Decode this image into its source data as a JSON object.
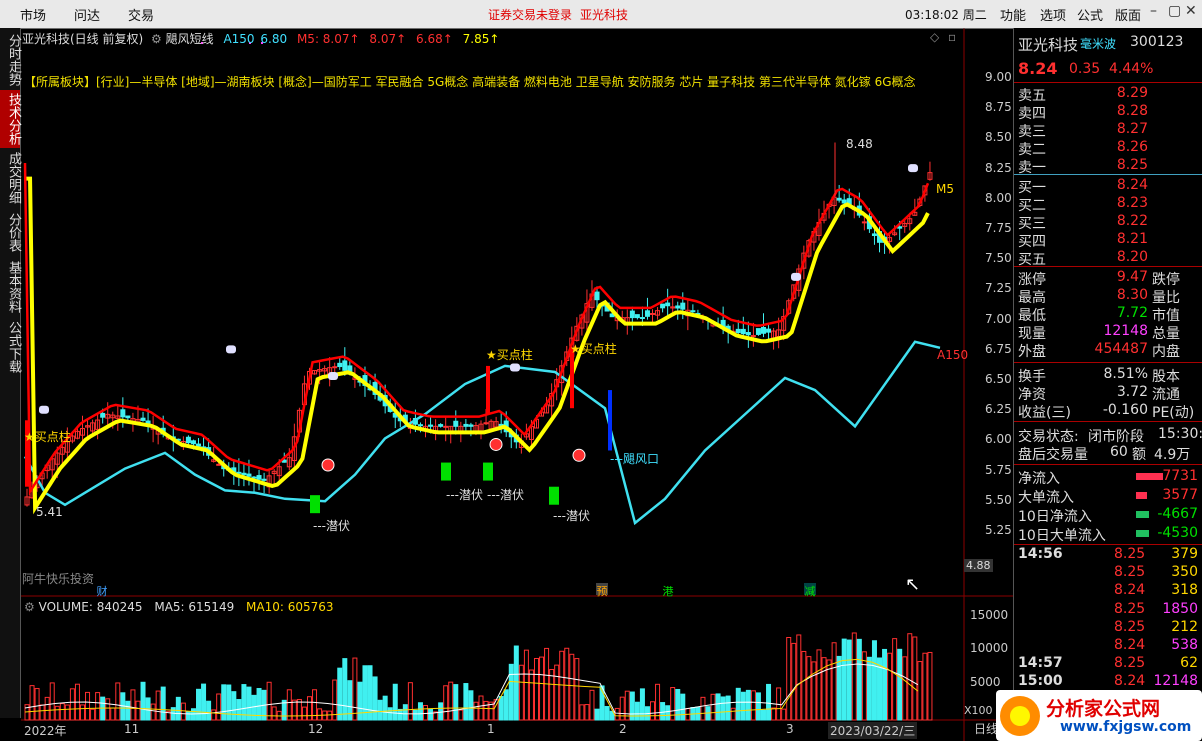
{
  "topbar": {
    "menu": [
      "市场",
      "问达",
      "交易"
    ],
    "warning": "证券交易未登录",
    "stock_name": "亚光科技",
    "clock": "03:18:02 周二",
    "right_menu": [
      "功能",
      "选项",
      "公式",
      "版面"
    ]
  },
  "left_tabs": [
    "分时走势",
    "技术分析",
    "成交明细",
    "分价表",
    "基本资料",
    "公式下载"
  ],
  "chart_header": {
    "title": "亚光科技(日线 前复权)",
    "indicator": "飓风短线",
    "a150_label": "A150",
    "a150_value": "6.80",
    "m5_label": "M5: 8.07",
    "values": [
      "8.07",
      "6.68",
      "7.85"
    ]
  },
  "sector_line": "【所属板块】[行业]—半导体 [地域]—湖南板块 [概念]—国防军工 军民融合 5G概念 高端装备 燃料电池 卫星导航 安防服务 芯片 量子科技 第三代半导体 氮化镓 6G概念",
  "annotations": {
    "buy": "★买点柱",
    "hide": "---潜伏",
    "wind": "---飓风口",
    "high": "8.48",
    "low": "5.41",
    "m5_tag": "M5",
    "a150_tag": "A150",
    "watermark_left": "阿牛快乐投资",
    "cursor_price": "4.88",
    "events": [
      "财",
      "预",
      "港",
      "减"
    ]
  },
  "price_axis": [
    "9.00",
    "8.75",
    "8.50",
    "8.25",
    "8.00",
    "7.75",
    "7.50",
    "7.25",
    "7.00",
    "6.75",
    "6.50",
    "6.25",
    "6.00",
    "5.75",
    "5.50",
    "5.25"
  ],
  "volume_header": {
    "volume": "VOLUME: 840245",
    "ma5": "MA5: 615149",
    "ma10": "MA10: 605763"
  },
  "volume_axis": [
    "15000",
    "10000",
    "5000"
  ],
  "volume_unit": "X100",
  "x_axis": [
    "2022年",
    "11",
    "12",
    "1",
    "2",
    "3",
    "2023/03/22/三"
  ],
  "right_panel": {
    "name": "亚光科技",
    "tag": "毫米波",
    "code": "300123",
    "price": "8.24",
    "change": "0.35",
    "pct": "4.44%",
    "asks": [
      {
        "label": "卖五",
        "price": "8.29"
      },
      {
        "label": "卖四",
        "price": "8.28"
      },
      {
        "label": "卖三",
        "price": "8.27"
      },
      {
        "label": "卖二",
        "price": "8.26"
      },
      {
        "label": "卖一",
        "price": "8.25"
      }
    ],
    "bids": [
      {
        "label": "买一",
        "price": "8.24"
      },
      {
        "label": "买二",
        "price": "8.23"
      },
      {
        "label": "买三",
        "price": "8.22"
      },
      {
        "label": "买四",
        "price": "8.21"
      },
      {
        "label": "买五",
        "price": "8.20"
      }
    ],
    "stats": [
      {
        "l": "涨停",
        "v": "9.47",
        "c": "red",
        "r": "跌停"
      },
      {
        "l": "最高",
        "v": "8.30",
        "c": "red",
        "r": "量比"
      },
      {
        "l": "最低",
        "v": "7.72",
        "c": "green",
        "r": "市值"
      },
      {
        "l": "现量",
        "v": "12148",
        "c": "magenta",
        "r": "总量"
      },
      {
        "l": "外盘",
        "v": "454487",
        "c": "red",
        "r": "内盘"
      }
    ],
    "stats2": [
      {
        "l": "换手",
        "v": "8.51%",
        "r": "股本"
      },
      {
        "l": "净资",
        "v": "3.72",
        "r": "流通"
      },
      {
        "l": "收益(三)",
        "v": "-0.160",
        "r": "PE(动)"
      }
    ],
    "status": {
      "l": "交易状态:",
      "v": "闭市阶段",
      "t": "15:30:"
    },
    "after": {
      "l": "盘后交易量",
      "v": "60",
      "r": "额",
      "r2": "4.9万"
    },
    "flows": [
      {
        "l": "净流入",
        "v": "7731",
        "c": "red",
        "bar": 0.95
      },
      {
        "l": "大单流入",
        "v": "3577",
        "c": "red",
        "bar": 0.4
      },
      {
        "l": "10日净流入",
        "v": "-4667",
        "c": "green",
        "bar": 0.45
      },
      {
        "l": "10日大单流入",
        "v": "-4530",
        "c": "green",
        "bar": 0.45
      }
    ],
    "ticks": [
      {
        "t": "14:56",
        "p": "8.25",
        "v": "379",
        "c": "yellow"
      },
      {
        "t": "",
        "p": "8.25",
        "v": "350",
        "c": "yellow"
      },
      {
        "t": "",
        "p": "8.24",
        "v": "318",
        "c": "yellow"
      },
      {
        "t": "",
        "p": "8.25",
        "v": "1850",
        "c": "magenta"
      },
      {
        "t": "",
        "p": "8.25",
        "v": "212",
        "c": "yellow"
      },
      {
        "t": "",
        "p": "8.24",
        "v": "538",
        "c": "magenta"
      },
      {
        "t": "14:57",
        "p": "8.25",
        "v": "62",
        "c": "yellow"
      },
      {
        "t": "15:00",
        "p": "8.24",
        "v": "12148",
        "c": "magenta"
      }
    ]
  },
  "colors": {
    "up": "#ff3030",
    "down": "#40f0f0",
    "ma_yellow": "#ffff00",
    "ma_red": "#ff0000",
    "long_cyan": "#40e0f0",
    "accent": "#b00000"
  }
}
